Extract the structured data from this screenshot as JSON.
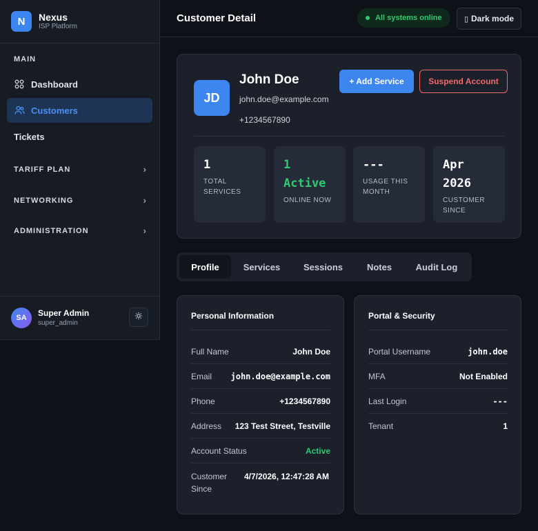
{
  "brand": {
    "logo_letter": "N",
    "name": "Nexus",
    "subtitle": "ISP Platform"
  },
  "sidebar": {
    "main_section": "MAIN",
    "items": [
      {
        "label": "Dashboard",
        "icon": "grid-icon"
      },
      {
        "label": "Customers",
        "icon": "users-icon",
        "active": true
      },
      {
        "label": "Tickets"
      }
    ],
    "groups": [
      {
        "label": "TARIFF PLAN",
        "chevron": "›"
      },
      {
        "label": "NETWORKING",
        "chevron": "›"
      },
      {
        "label": "ADMINISTRATION",
        "chevron": "›"
      }
    ],
    "user": {
      "initials": "SA",
      "name": "Super Admin",
      "handle": "super_admin"
    }
  },
  "header": {
    "title": "Customer Detail",
    "status": "All systems online",
    "dark_mode_glyph": "▯",
    "dark_mode_label": "Dark mode"
  },
  "customer": {
    "initials": "JD",
    "name": "John Doe",
    "email": "john.doe@example.com",
    "phone": "+1234567890",
    "add_service_label": "+ Add Service",
    "suspend_label": "Suspend Account"
  },
  "stats": [
    {
      "value": "1",
      "label": "TOTAL SERVICES"
    },
    {
      "value": "1 Active",
      "label": "ONLINE NOW"
    },
    {
      "value": "---",
      "label": "USAGE THIS MONTH"
    },
    {
      "value": "Apr 2026",
      "label": "CUSTOMER SINCE"
    }
  ],
  "tabs": [
    "Profile",
    "Services",
    "Sessions",
    "Notes",
    "Audit Log"
  ],
  "personal": {
    "title": "Personal Information",
    "rows": [
      {
        "key": "Full Name",
        "value": "John Doe"
      },
      {
        "key": "Email",
        "value": "john.doe@example.com"
      },
      {
        "key": "Phone",
        "value": "+1234567890"
      },
      {
        "key": "Address",
        "value": "123 Test Street, Testville"
      },
      {
        "key": "Account Status",
        "value": "Active"
      },
      {
        "key": "Customer Since",
        "value": "4/7/2026, 12:47:28 AM"
      }
    ]
  },
  "portal": {
    "title": "Portal & Security",
    "rows": [
      {
        "key": "Portal Username",
        "value": "john.doe"
      },
      {
        "key": "MFA",
        "value": "Not Enabled"
      },
      {
        "key": "Last Login",
        "value": "---"
      },
      {
        "key": "Tenant",
        "value": "1"
      }
    ]
  },
  "colors": {
    "accent": "#3d86f0",
    "success": "#2fca6f",
    "danger": "#ef6a6a",
    "background": "#0e1117",
    "surface": "#1b202b"
  }
}
